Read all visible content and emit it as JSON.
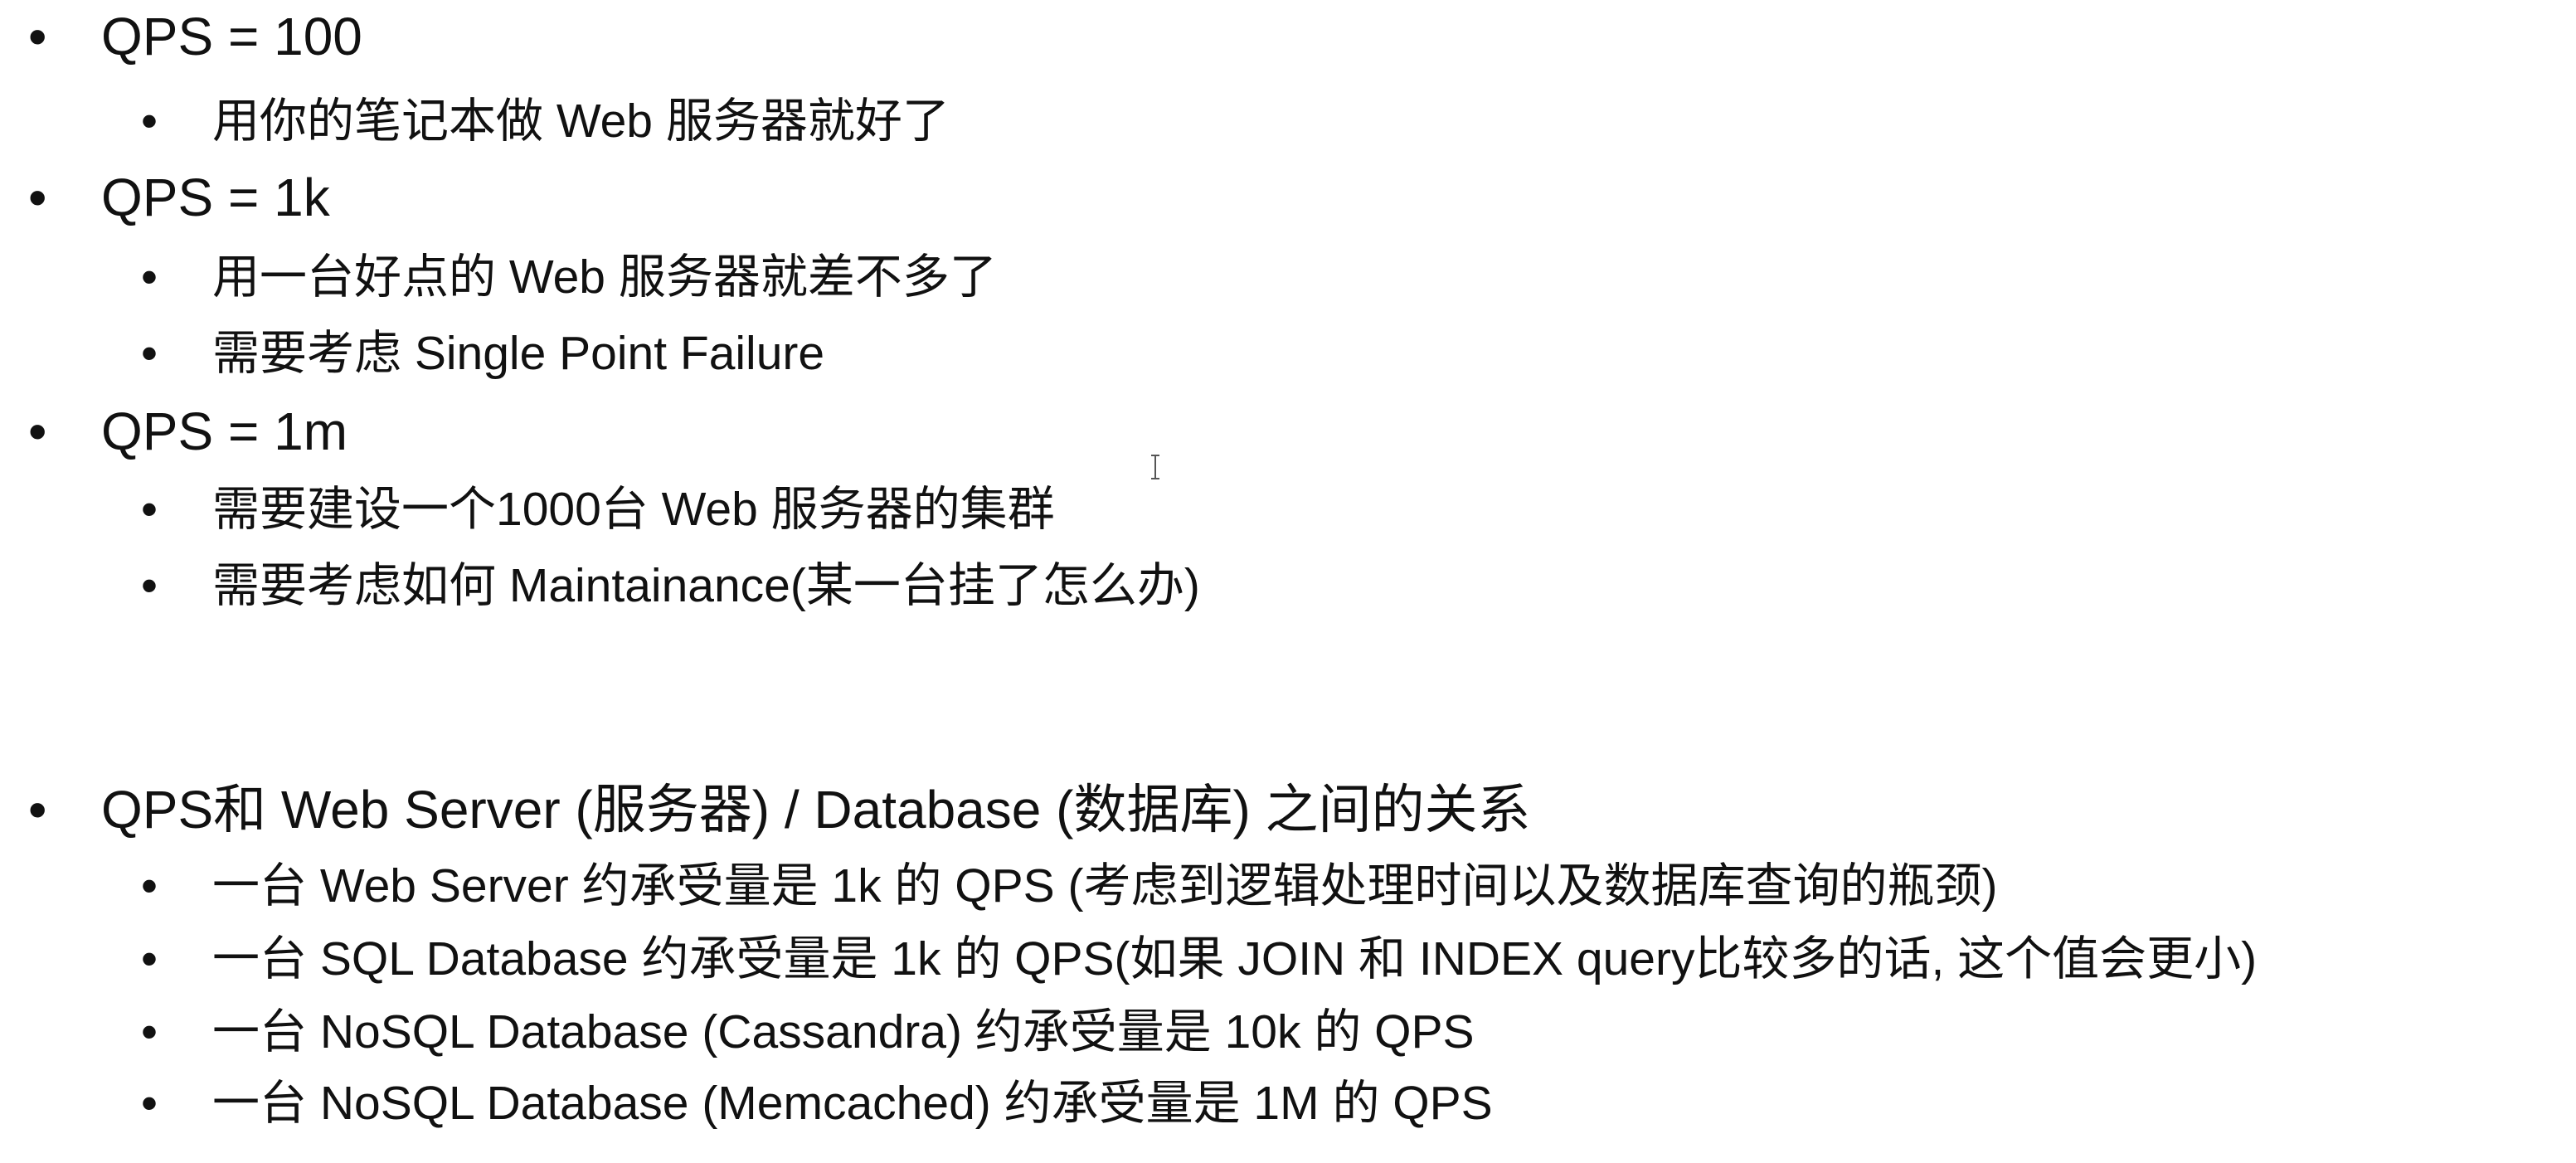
{
  "bullet_char": "•",
  "lines": [
    {
      "level": 1,
      "text": "QPS = 100"
    },
    {
      "level": 2,
      "text": "用你的笔记本做 Web 服务器就好了"
    },
    {
      "level": 1,
      "text": "QPS = 1k"
    },
    {
      "level": 2,
      "text": "用一台好点的 Web 服务器就差不多了"
    },
    {
      "level": 2,
      "text": "需要考虑 Single Point Failure"
    },
    {
      "level": 1,
      "text": "QPS = 1m"
    },
    {
      "level": 2,
      "text": "需要建设一个1000台 Web 服务器的集群"
    },
    {
      "level": 2,
      "text": "需要考虑如何 Maintainance(某一台挂了怎么办)"
    },
    {
      "level": 1,
      "text": "QPS和 Web Server (服务器) / Database (数据库) 之间的关系"
    },
    {
      "level": 2,
      "text": "一台 Web Server 约承受量是 1k 的 QPS (考虑到逻辑处理时间以及数据库查询的瓶颈)"
    },
    {
      "level": 2,
      "text": "一台 SQL Database 约承受量是 1k 的 QPS(如果 JOIN 和 INDEX query比较多的话, 这个值会更小)"
    },
    {
      "level": 2,
      "text": "一台 NoSQL Database (Cassandra) 约承受量是 10k 的 QPS"
    },
    {
      "level": 2,
      "text": "一台 NoSQL Database (Memcached) 约承受量是 1M 的 QPS"
    }
  ]
}
